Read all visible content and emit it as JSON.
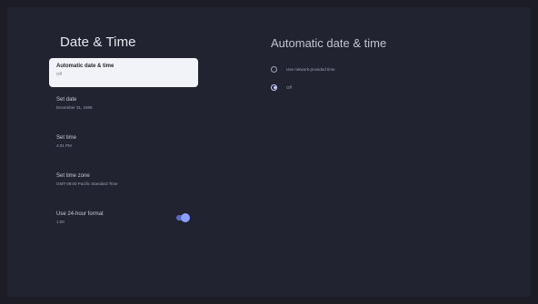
{
  "screen": {
    "title": "Date & Time"
  },
  "menu": {
    "items": [
      {
        "label": "Automatic date & time",
        "value": "Off"
      },
      {
        "label": "Set date",
        "value": "December 31, 1969"
      },
      {
        "label": "Set time",
        "value": "4:01 PM"
      },
      {
        "label": "Set time zone",
        "value": "GMT-08:00 Pacific Standard Time"
      },
      {
        "label": "Use 24-hour format",
        "value": "1:00",
        "toggle": true
      }
    ]
  },
  "panel": {
    "title": "Automatic date & time",
    "options": [
      {
        "label": "Use network-provided time"
      },
      {
        "label": "Off"
      }
    ]
  },
  "colors": {
    "background": "#1c1d24",
    "surface": "#222330",
    "selected": "#f2f3f8",
    "accent": "#8ea0ff"
  }
}
